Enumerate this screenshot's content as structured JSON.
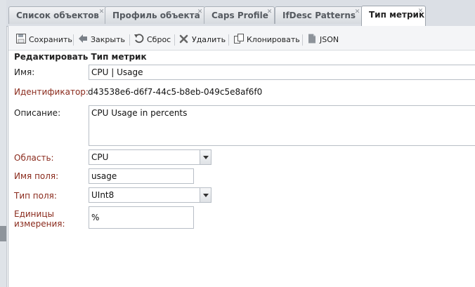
{
  "tabs": [
    {
      "label": "Список объектов"
    },
    {
      "label": "Профиль объекта"
    },
    {
      "label": "Caps Profile"
    },
    {
      "label": "IfDesc Patterns"
    },
    {
      "label": "Тип метрик"
    }
  ],
  "toolbar": {
    "save": "Сохранить",
    "close": "Закрыть",
    "reset": "Сброс",
    "delete": "Удалить",
    "clone": "Клонировать",
    "json": "JSON"
  },
  "form": {
    "title": "Редактировать Тип метрик",
    "name_label": "Имя:",
    "name_value": "CPU | Usage",
    "id_label": "Идентификатор:",
    "id_value": "d43538e6-d6f7-44c5-b8eb-049c5e8af6f0",
    "description_label": "Описание:",
    "description_value": "CPU Usage in percents",
    "scope_label": "Область:",
    "scope_value": "CPU",
    "field_name_label": "Имя поля:",
    "field_name_value": "usage",
    "field_type_label": "Тип поля:",
    "field_type_value": "UInt8",
    "units_label": "Единицы измерения:",
    "units_value": "%"
  }
}
